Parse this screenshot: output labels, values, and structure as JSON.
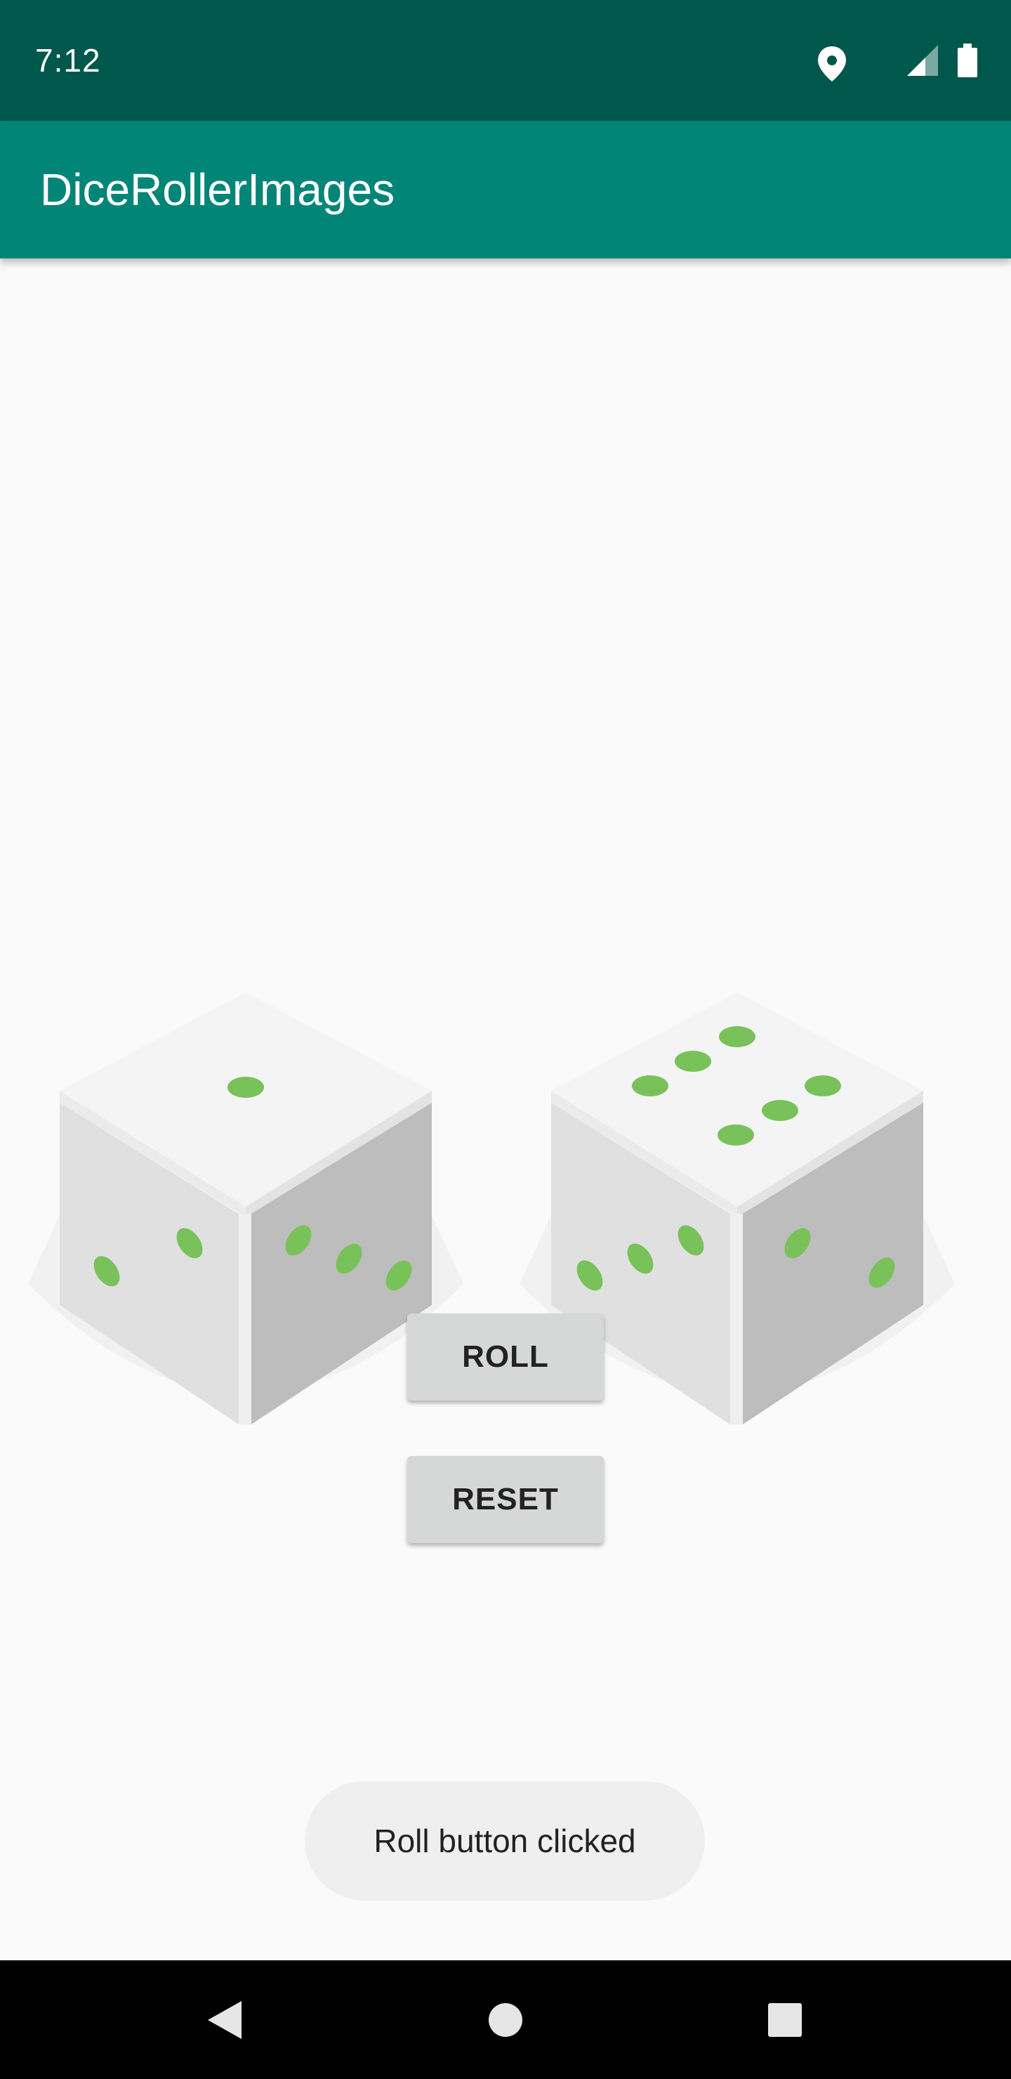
{
  "status_bar": {
    "time": "7:12",
    "icons": [
      "location-icon",
      "signal-icon",
      "battery-icon"
    ]
  },
  "app_bar": {
    "title": "DiceRollerImages"
  },
  "dice": [
    {
      "name": "left-die",
      "top_face": 1,
      "left_face": 2,
      "right_face": 3
    },
    {
      "name": "right-die",
      "top_face": 6,
      "left_face": 3,
      "right_face": 2
    }
  ],
  "buttons": {
    "roll_label": "ROLL",
    "reset_label": "RESET"
  },
  "toast": {
    "message": "Roll button clicked"
  },
  "nav_bar": {
    "icons": [
      "back-icon",
      "home-icon",
      "recents-icon"
    ]
  },
  "colors": {
    "status_bar": "#00574b",
    "app_bar": "#008577",
    "pip": "#79c25a",
    "background": "#fafafa"
  }
}
